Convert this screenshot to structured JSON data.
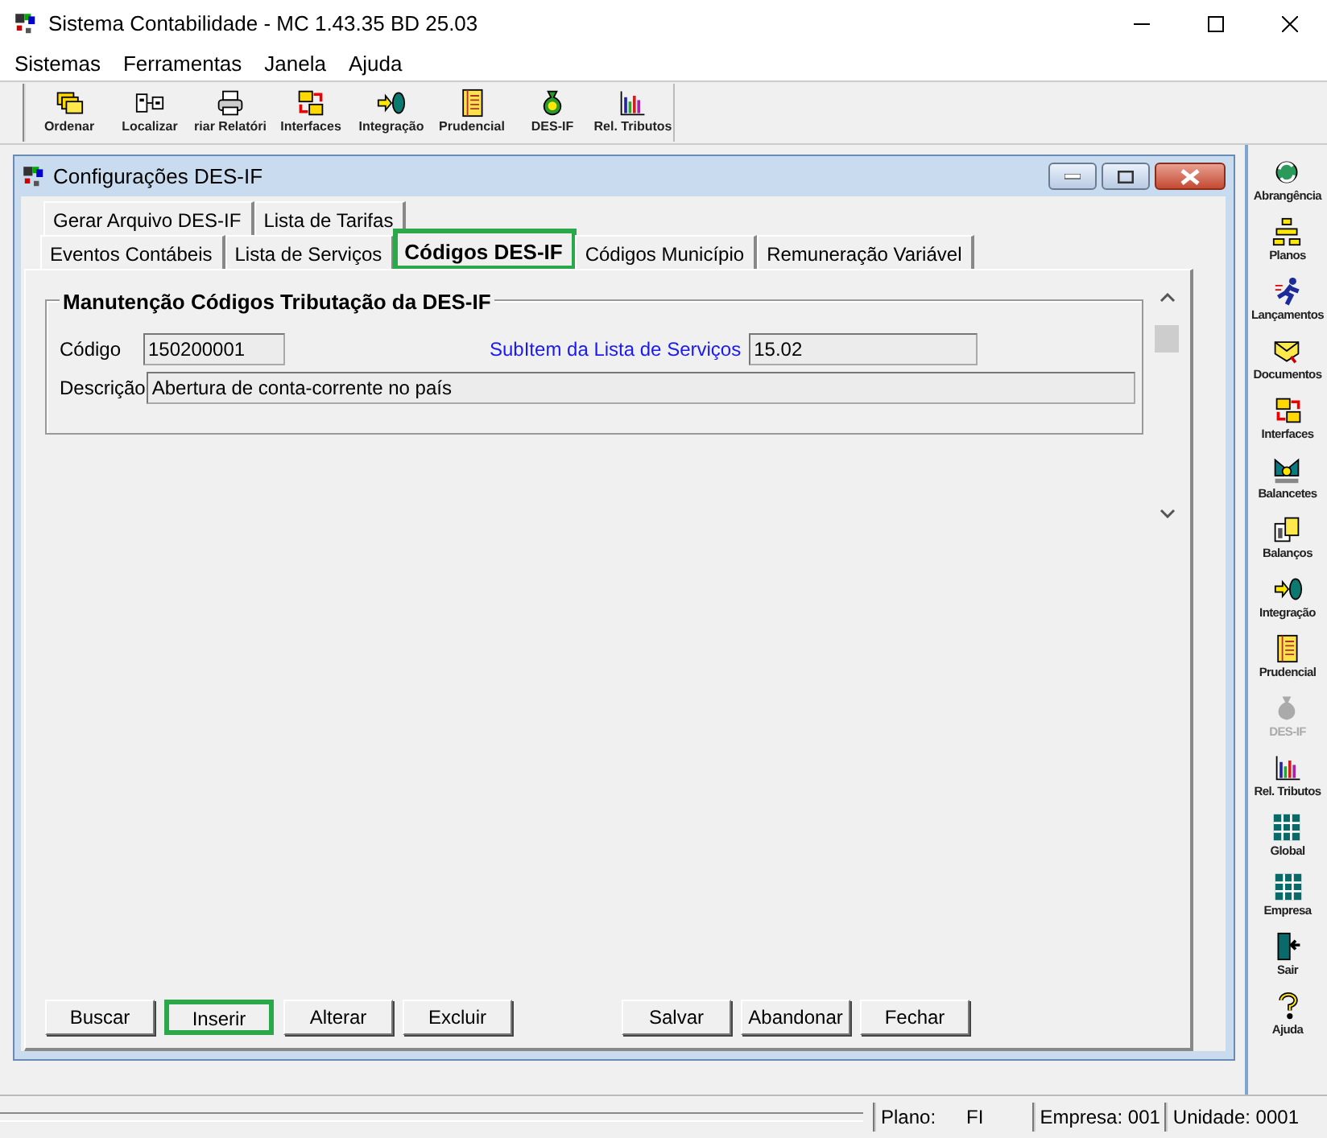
{
  "window": {
    "title": "Sistema Contabilidade -  MC 1.43.35 BD 25.03"
  },
  "menu": [
    "Sistemas",
    "Ferramentas",
    "Janela",
    "Ajuda"
  ],
  "toolbar": [
    {
      "label": "Ordenar"
    },
    {
      "label": "Localizar"
    },
    {
      "label": "riar Relatóri"
    },
    {
      "label": "Interfaces"
    },
    {
      "label": "Integração"
    },
    {
      "label": "Prudencial"
    },
    {
      "label": "DES-IF"
    },
    {
      "label": "Rel. Tributos"
    }
  ],
  "child_window": {
    "title": "Configurações DES-IF",
    "tab_rows": [
      [
        {
          "label": "Gerar Arquivo DES-IF",
          "selected": false,
          "highlighted": false
        },
        {
          "label": "Lista de Tarifas",
          "selected": false,
          "highlighted": false
        }
      ],
      [
        {
          "label": "Eventos Contábeis",
          "selected": false,
          "highlighted": false
        },
        {
          "label": "Lista de Serviços",
          "selected": false,
          "highlighted": false
        },
        {
          "label": "Códigos DES-IF",
          "selected": true,
          "highlighted": true
        },
        {
          "label": "Códigos Município",
          "selected": false,
          "highlighted": false
        },
        {
          "label": "Remuneração Variável",
          "selected": false,
          "highlighted": false
        }
      ]
    ],
    "group": {
      "title": "Manutenção Códigos Tributação da DES-IF",
      "code": {
        "label": "Código",
        "value": "150200001"
      },
      "subitem": {
        "label": "SubItem da Lista de Serviços",
        "value": "15.02"
      },
      "description": {
        "label": "Descrição",
        "value": "Abertura de conta-corrente no país"
      }
    },
    "button_groups": [
      [
        {
          "label": "Buscar",
          "highlighted": false
        },
        {
          "label": "Inserir",
          "highlighted": true
        },
        {
          "label": "Alterar",
          "highlighted": false
        },
        {
          "label": "Excluir",
          "highlighted": false
        }
      ],
      [
        {
          "label": "Salvar",
          "highlighted": false
        },
        {
          "label": "Abandonar",
          "highlighted": false
        },
        {
          "label": "Fechar",
          "highlighted": false
        }
      ]
    ]
  },
  "sidebar": [
    {
      "label": "Abrangência",
      "disabled": false
    },
    {
      "label": "Planos",
      "disabled": false
    },
    {
      "label": "Lançamentos",
      "disabled": false
    },
    {
      "label": "Documentos",
      "disabled": false
    },
    {
      "label": "Interfaces",
      "disabled": false
    },
    {
      "label": "Balancetes",
      "disabled": false
    },
    {
      "label": "Balanços",
      "disabled": false
    },
    {
      "label": "Integração",
      "disabled": false
    },
    {
      "label": "Prudencial",
      "disabled": false
    },
    {
      "label": "DES-IF",
      "disabled": true
    },
    {
      "label": "Rel. Tributos",
      "disabled": false
    },
    {
      "label": "Global",
      "disabled": false
    },
    {
      "label": "Empresa",
      "disabled": false
    },
    {
      "label": "Sair",
      "disabled": false
    },
    {
      "label": "Ajuda",
      "disabled": false
    }
  ],
  "status_bar": {
    "plano_label": "Plano:",
    "plano_value": "FI",
    "empresa": "Empresa: 001",
    "unidade": "Unidade: 0001"
  }
}
